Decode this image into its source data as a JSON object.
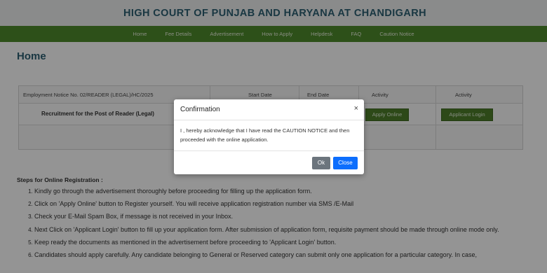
{
  "header": {
    "title": "HIGH COURT OF PUNJAB AND HARYANA AT CHANDIGARH"
  },
  "nav": [
    "Home",
    "Fee Details",
    "Advertisement",
    "How to Apply",
    "Helpdesk",
    "FAQ",
    "Caution Notice"
  ],
  "page": {
    "title": "Home"
  },
  "notice_table": {
    "notice": "Employment Notice No. 02/READER (LEGAL)/HC/2025",
    "start_date_header": "Start Date",
    "end_date_header": "End Date",
    "activity_header_1": "Activity",
    "activity_header_2": "Activity",
    "post_title": "Recruitment for the Post of Reader (Legal)",
    "apply_online": "Apply Online",
    "applicant_login": "Applicant Login"
  },
  "steps": {
    "title": "Steps for Online Registration :",
    "items": [
      "Kindly go through the advertisement thoroughly before proceeding for filling up the application form.",
      "Click on 'Apply Online' button to Register yourself. You will receive application registration number via SMS /E-Mail",
      "Check your E-Mail Spam Box, if message is not received in your Inbox.",
      "Next Click on 'Applicant Login' button to fill up your application form. After submission of application form, requisite payment should be made through online mode only.",
      "Keep ready the documents as mentioned in the advertisement before proceeding to 'Applicant Login' button.",
      "Candidates should apply carefully. Any candidate belonging to General or Reserved category can submit only one application for a particular category. In case,"
    ]
  },
  "modal": {
    "title": "Confirmation",
    "close_symbol": "×",
    "body": "I , hereby acknowledge that I have read the CAUTION NOTICE and then proceeded with the online application.",
    "ok_label": "Ok",
    "close_label": "Close"
  },
  "colors": {
    "nav_green": "#4f8a2c",
    "title_blue": "#2c5f73",
    "button_green": "#4e7f2a",
    "ok_gray": "#6c757d",
    "close_blue": "#0d6efd"
  }
}
